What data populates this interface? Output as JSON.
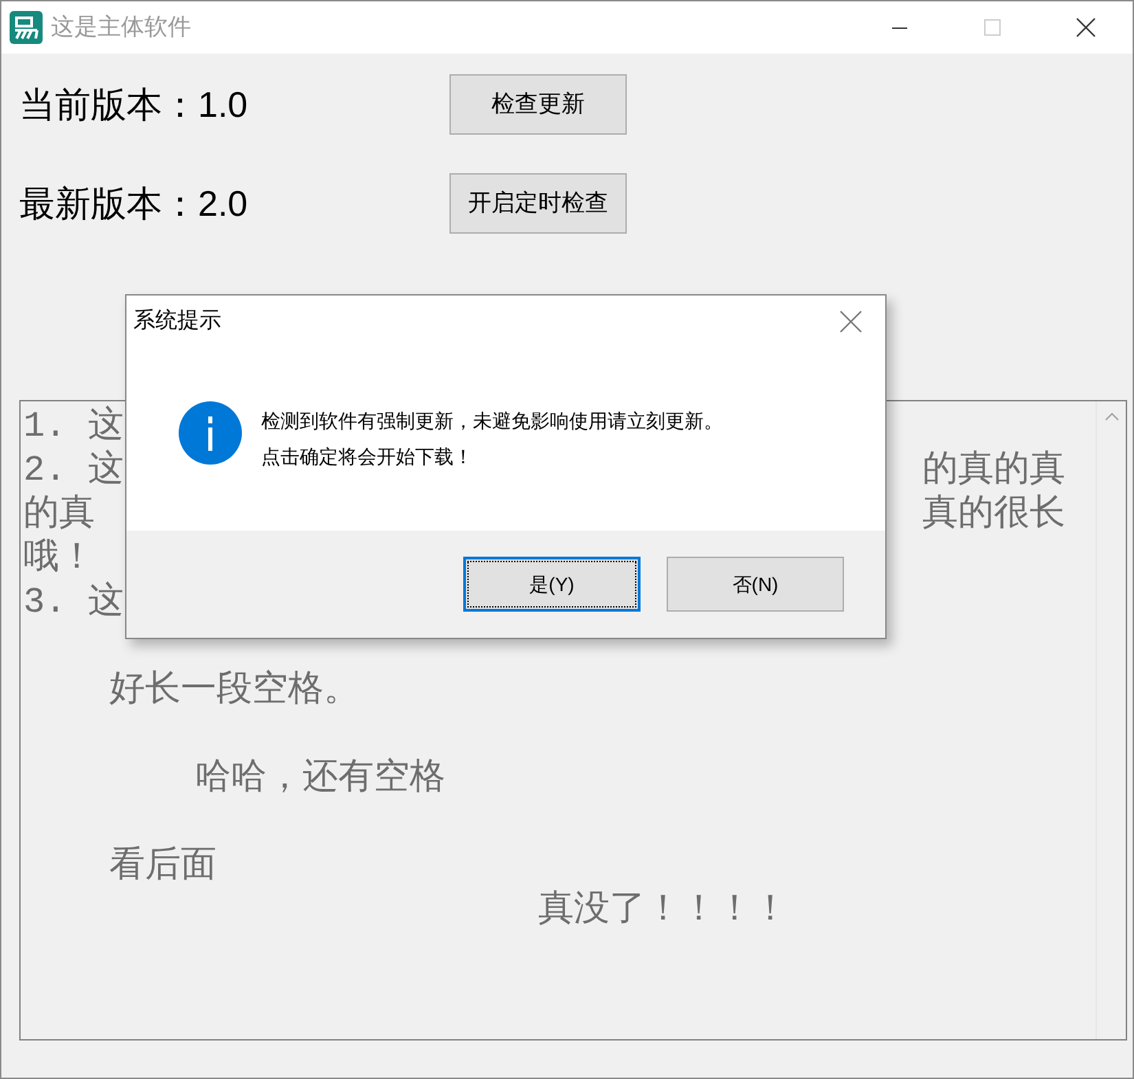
{
  "window": {
    "title": "这是主体软件",
    "controls": [
      {
        "kind": "minimize",
        "disabled": false
      },
      {
        "kind": "maximize",
        "disabled": true
      },
      {
        "kind": "close",
        "disabled": false
      }
    ]
  },
  "versions": [
    {
      "label": "当前版本：1.0",
      "button": "检查更新"
    },
    {
      "label": "最新版本：2.0",
      "button": "开启定时检查"
    }
  ],
  "text_area": {
    "lines": [
      {
        "kind": "text",
        "text": "1. 这"
      },
      {
        "kind": "split",
        "left": "2. 这",
        "right": "的真的真"
      },
      {
        "kind": "split",
        "left": "的真",
        "right": "真的很长"
      },
      {
        "kind": "text",
        "text": "哦！"
      },
      {
        "kind": "text",
        "text": "3. 这"
      },
      {
        "kind": "blank"
      },
      {
        "kind": "text",
        "text": "    好长一段空格。"
      },
      {
        "kind": "blank"
      },
      {
        "kind": "text",
        "text": "        哈哈，还有空格"
      },
      {
        "kind": "blank"
      },
      {
        "kind": "text",
        "text": "    看后面"
      },
      {
        "kind": "text",
        "text": "                        真没了！！！！"
      }
    ]
  },
  "dialog": {
    "title": "系统提示",
    "message": [
      "检测到软件有强制更新，未避免影响使用请立刻更新。",
      "点击确定将会开始下载！"
    ],
    "buttons": [
      {
        "label": "是(Y)",
        "selected": true
      },
      {
        "label": "否(N)",
        "selected": false
      }
    ]
  }
}
